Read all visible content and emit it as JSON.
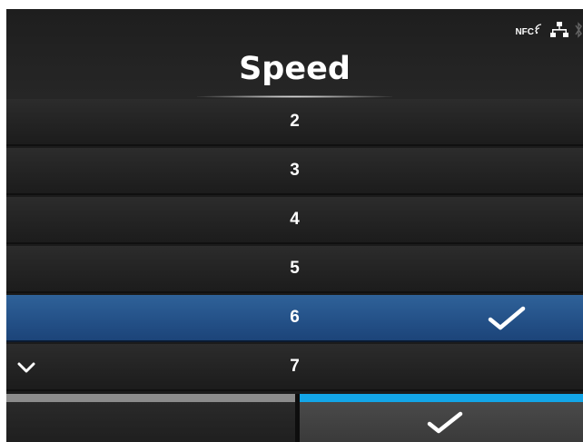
{
  "header": {
    "title": "Speed",
    "status": {
      "nfc_label": "NFC",
      "icons": [
        "nfc-icon",
        "wired-lan-icon",
        "bluetooth-icon"
      ]
    }
  },
  "list": {
    "items": [
      {
        "label": "2",
        "selected": false
      },
      {
        "label": "3",
        "selected": false
      },
      {
        "label": "4",
        "selected": false
      },
      {
        "label": "5",
        "selected": false
      },
      {
        "label": "6",
        "selected": true
      },
      {
        "label": "7",
        "selected": false
      }
    ],
    "selected_value": "6",
    "selected_icon": "checkmark-icon",
    "scroll_indicator_icon": "chevron-down-icon"
  },
  "footer": {
    "left_button_icon": "",
    "right_button_icon": "checkmark-icon"
  },
  "colors": {
    "background": "#1b1b1b",
    "selected_row": "#245188",
    "accent_strip": "#13a6e8",
    "inactive_strip": "#8c8c8c",
    "text": "#ffffff"
  }
}
